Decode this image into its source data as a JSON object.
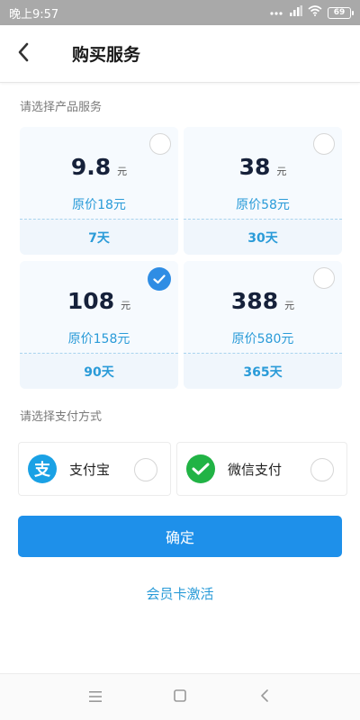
{
  "status_bar": {
    "time": "晚上9:57",
    "signal_icon": "signal-dots-icon",
    "wifi_icon": "wifi-icon",
    "battery": "69"
  },
  "header": {
    "back_icon": "chevron-left-icon",
    "title": "购买服务"
  },
  "products": {
    "section_label": "请选择产品服务",
    "items": [
      {
        "price": "9.8",
        "unit": "元",
        "original": "原价18元",
        "duration": "7天",
        "selected": false
      },
      {
        "price": "38",
        "unit": "元",
        "original": "原价58元",
        "duration": "30天",
        "selected": false
      },
      {
        "price": "108",
        "unit": "元",
        "original": "原价158元",
        "duration": "90天",
        "selected": true
      },
      {
        "price": "388",
        "unit": "元",
        "original": "原价580元",
        "duration": "365天",
        "selected": false
      }
    ]
  },
  "payment": {
    "section_label": "请选择支付方式",
    "methods": [
      {
        "label": "支付宝",
        "icon": "alipay-icon",
        "icon_glyph": "支",
        "color": "#1aa1e5",
        "selected": false
      },
      {
        "label": "微信支付",
        "icon": "wechat-pay-icon",
        "color": "#21b345",
        "selected": false
      }
    ]
  },
  "actions": {
    "confirm_label": "确定",
    "activate_label": "会员卡激活"
  },
  "nav_bar": {
    "menu_icon": "menu-icon",
    "home_icon": "home-square-icon",
    "back_icon": "back-triangle-icon"
  },
  "colors": {
    "accent": "#1e90ea",
    "link": "#2a9bd8",
    "card_bg": "#f0f6fc",
    "check": "#2f8de4"
  }
}
